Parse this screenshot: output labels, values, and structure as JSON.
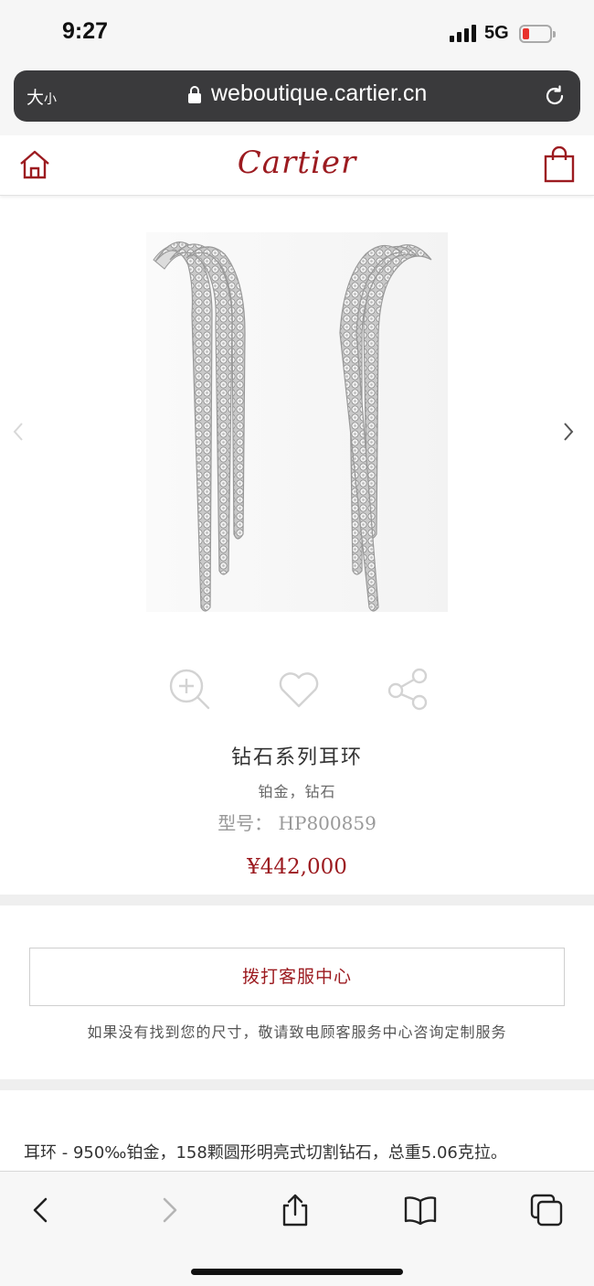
{
  "status_bar": {
    "time": "9:27",
    "network": "5G"
  },
  "browser": {
    "text_size_label": "大",
    "text_size_small": "小",
    "url": "weboutique.cartier.cn"
  },
  "header": {
    "brand": "Cartier"
  },
  "product": {
    "name": "钻石系列耳环",
    "material": "铂金，钻石",
    "reference": "型号： HP800859",
    "price": "¥442,000"
  },
  "service": {
    "call_button": "拨打客服中心",
    "note": "如果没有找到您的尺寸，敬请致电顾客服务中心咨询定制服务"
  },
  "description": "耳环 - 950‰铂金，158颗圆形明亮式切割钻石，总重5.06克拉。",
  "colors": {
    "brand_red": "#9c1b20",
    "address_bar": "#3a3a3c",
    "battery_low": "#e8322c"
  },
  "icons": {
    "actions": [
      "zoom-icon",
      "heart-icon",
      "share-icon"
    ],
    "toolbar": [
      "back-icon",
      "forward-icon",
      "share-icon",
      "bookmarks-icon",
      "tabs-icon"
    ]
  }
}
